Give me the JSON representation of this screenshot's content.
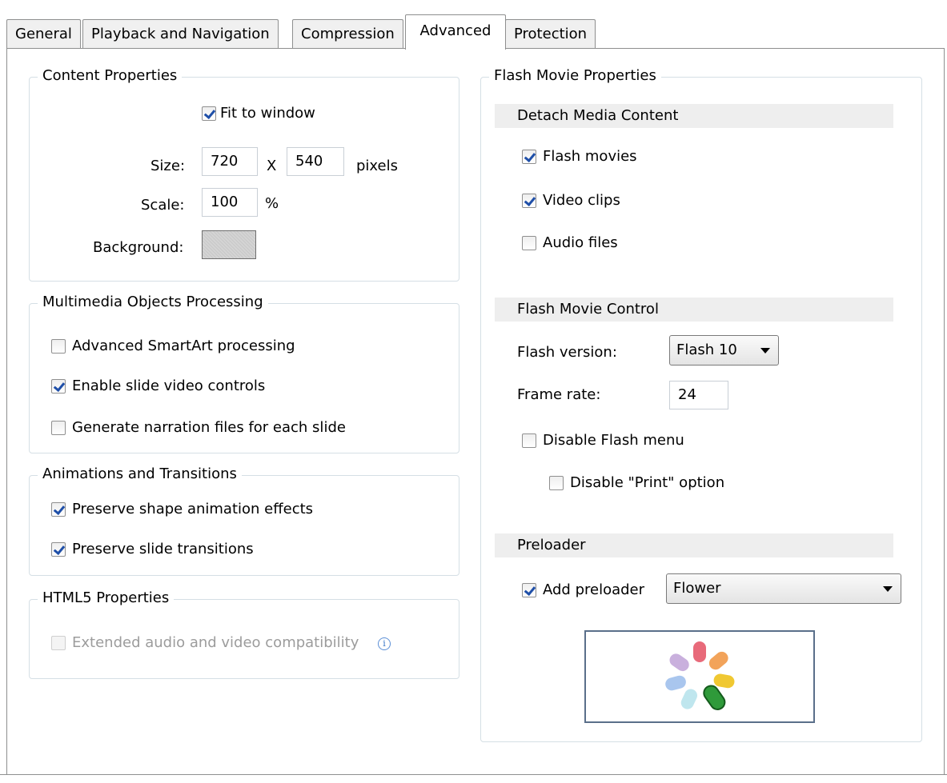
{
  "tabs": [
    {
      "label": "General"
    },
    {
      "label": "Playback and Navigation"
    },
    {
      "label": "Compression"
    },
    {
      "label": "Advanced"
    },
    {
      "label": "Protection"
    }
  ],
  "content_properties": {
    "title": "Content Properties",
    "fit_to_window": {
      "label": "Fit to window",
      "checked": true
    },
    "size_label": "Size:",
    "width": "720",
    "x_label": "X",
    "height": "540",
    "pixels_label": "pixels",
    "scale_label": "Scale:",
    "scale": "100",
    "percent_label": "%",
    "background_label": "Background:"
  },
  "multimedia": {
    "title": "Multimedia Objects Processing",
    "advanced_smartart": {
      "label": "Advanced SmartArt processing",
      "checked": false
    },
    "enable_video_controls": {
      "label": "Enable slide video controls",
      "checked": true
    },
    "generate_narration": {
      "label": "Generate narration files for each slide",
      "checked": false
    }
  },
  "animations": {
    "title": "Animations and Transitions",
    "preserve_shape_animation": {
      "label": "Preserve shape animation effects",
      "checked": true
    },
    "preserve_slide_transitions": {
      "label": "Preserve slide transitions",
      "checked": true
    }
  },
  "html5": {
    "title": "HTML5 Properties",
    "extended_compat": {
      "label": "Extended audio and video compatibility",
      "checked": false,
      "disabled": true
    }
  },
  "flash": {
    "title": "Flash Movie Properties",
    "detach_head": "Detach Media Content",
    "flash_movies": {
      "label": "Flash movies",
      "checked": true
    },
    "video_clips": {
      "label": "Video clips",
      "checked": true
    },
    "audio_files": {
      "label": "Audio files",
      "checked": false
    },
    "control_head": "Flash Movie Control",
    "version_label": "Flash version:",
    "version_value": "Flash 10",
    "frame_rate_label": "Frame rate:",
    "frame_rate": "24",
    "disable_menu": {
      "label": "Disable Flash menu",
      "checked": false
    },
    "disable_print": {
      "label": "Disable \"Print\" option",
      "checked": false
    },
    "preloader_head": "Preloader",
    "add_preloader": {
      "label": "Add preloader",
      "checked": true
    },
    "preloader_style": "Flower"
  },
  "colors": {
    "tab_border": "#8e8f8f",
    "group_border": "#d5dfe5",
    "section_head_bg": "#eeeeee",
    "checkmark": "#1f4fa8"
  }
}
